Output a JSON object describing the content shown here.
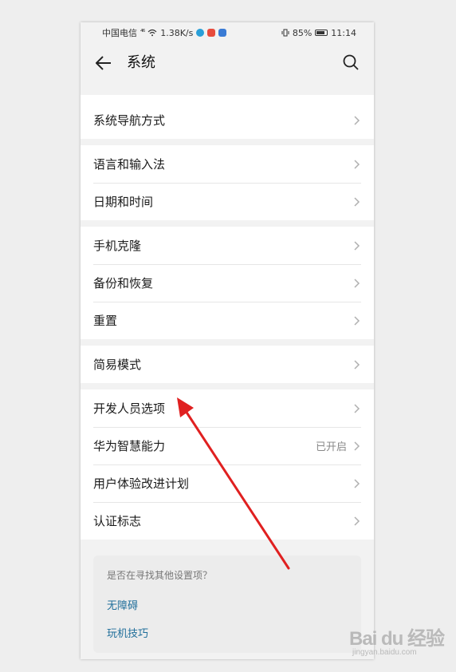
{
  "statusbar": {
    "carrier": "中国电信",
    "signal": "⁴⁶",
    "speed": "1.38K/s",
    "battery": "85%",
    "time": "11:14"
  },
  "appbar": {
    "title": "系统"
  },
  "groups": [
    {
      "items": [
        {
          "label": "系统导航方式",
          "value": ""
        }
      ]
    },
    {
      "items": [
        {
          "label": "语言和输入法",
          "value": ""
        },
        {
          "label": "日期和时间",
          "value": ""
        }
      ]
    },
    {
      "items": [
        {
          "label": "手机克隆",
          "value": ""
        },
        {
          "label": "备份和恢复",
          "value": ""
        },
        {
          "label": "重置",
          "value": ""
        }
      ]
    },
    {
      "items": [
        {
          "label": "简易模式",
          "value": ""
        }
      ]
    },
    {
      "items": [
        {
          "label": "开发人员选项",
          "value": ""
        },
        {
          "label": "华为智慧能力",
          "value": "已开启"
        },
        {
          "label": "用户体验改进计划",
          "value": ""
        },
        {
          "label": "认证标志",
          "value": ""
        }
      ]
    }
  ],
  "suggest": {
    "question": "是否在寻找其他设置项？",
    "links": [
      "无障碍",
      "玩机技巧"
    ]
  },
  "watermark": {
    "brand": "Bai du 经验",
    "url": "jingyan.baidu.com"
  },
  "colors": {
    "annotation_arrow": "#e02020",
    "link": "#1f6e9a"
  }
}
